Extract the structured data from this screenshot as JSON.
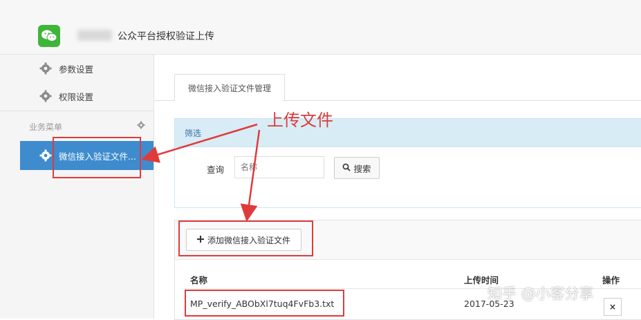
{
  "header": {
    "title": "公众平台授权验证上传"
  },
  "sidebar": {
    "items": [
      {
        "label": "参数设置",
        "icon": "gear-icon"
      },
      {
        "label": "权限设置",
        "icon": "gear-icon"
      }
    ],
    "section_title": "业务菜单",
    "active_item": {
      "label": "微信接入验证文件...",
      "icon": "gear-icon"
    }
  },
  "main": {
    "tab_label": "微信接入验证文件管理",
    "filter": {
      "title": "筛选",
      "query_label": "查询",
      "query_placeholder": "名称",
      "search_button": "搜索"
    },
    "list": {
      "add_button": "添加微信接入验证文件",
      "columns": [
        "名称",
        "上传时间",
        "操作"
      ],
      "rows": [
        {
          "name": "MP_verify_ABObXl7tuq4FvFb3.txt",
          "time": "2017-05-23",
          "action": "×"
        }
      ]
    }
  },
  "annotation": {
    "text": "上传文件"
  },
  "watermark": {
    "text": "知乎 @小客分享"
  },
  "colors": {
    "accent": "#3e8cce",
    "annotation": "#e03a3a",
    "filter_header": "#d8ecf6"
  }
}
